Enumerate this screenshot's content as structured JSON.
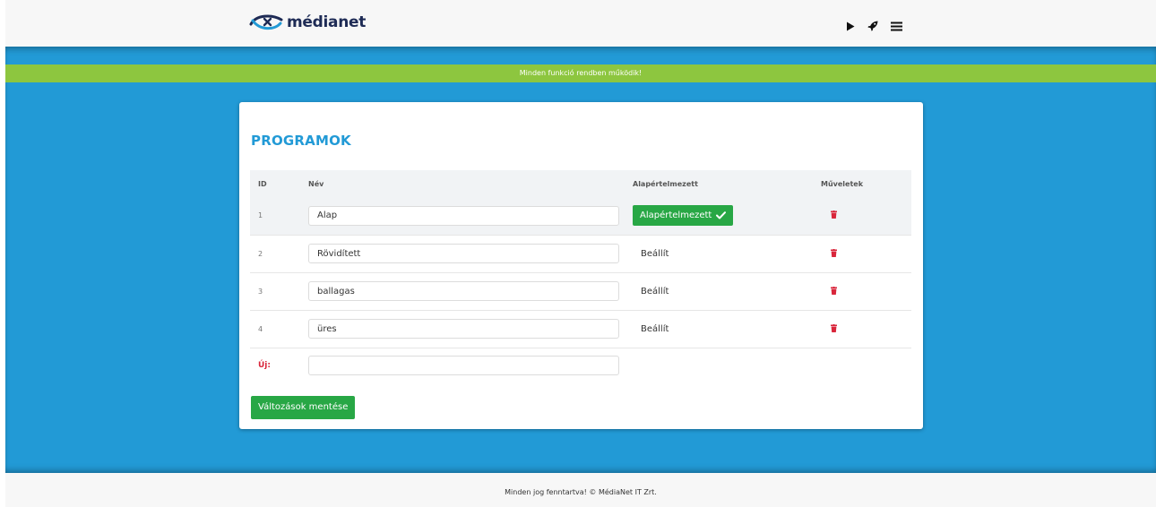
{
  "header": {
    "logo_text": "médianet",
    "icons": [
      "play-icon",
      "rocket-icon",
      "menu-icon"
    ]
  },
  "status_banner": "Minden funkció rendben működik!",
  "card": {
    "title": "PROGRAMOK",
    "columns": [
      "ID",
      "Név",
      "Alapértelmezett",
      "Műveletek"
    ],
    "rows": [
      {
        "id": "1",
        "name": "Alap",
        "default_label": "Alapértelmezett",
        "is_default": true
      },
      {
        "id": "2",
        "name": "Rövidített",
        "default_label": "Beállít",
        "is_default": false
      },
      {
        "id": "3",
        "name": "ballagas",
        "default_label": "Beállít",
        "is_default": false
      },
      {
        "id": "4",
        "name": "üres",
        "default_label": "Beállít",
        "is_default": false
      }
    ],
    "new_row_label": "Új:",
    "new_row_value": "",
    "save_label": "Változások mentése"
  },
  "footer": "Minden jog fenntartva! © MédiaNet IT Zrt.",
  "colors": {
    "brand_blue": "#229ad6",
    "success_green": "#28a745",
    "banner_green": "#8dc63f",
    "danger_red": "#d9263b"
  }
}
